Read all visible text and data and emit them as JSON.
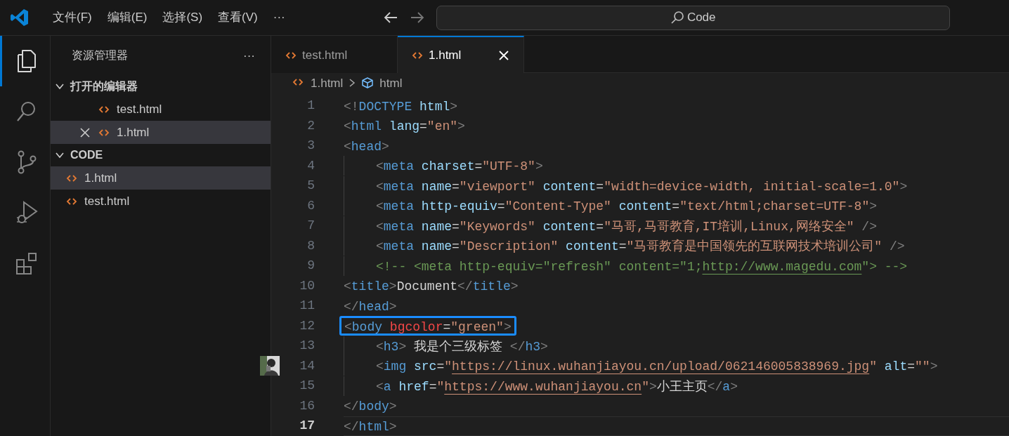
{
  "menu": [
    "文件(F)",
    "编辑(E)",
    "选择(S)",
    "查看(V)",
    "···"
  ],
  "command_center": {
    "text": "Code"
  },
  "activity_bar": [
    {
      "kind": "explorer",
      "selected": true
    },
    {
      "kind": "search",
      "selected": false
    },
    {
      "kind": "source-control",
      "selected": false
    },
    {
      "kind": "run-debug",
      "selected": false
    },
    {
      "kind": "extensions",
      "selected": false
    }
  ],
  "sidebar": {
    "title": "资源管理器",
    "more": "···",
    "sections": [
      {
        "title": "打开的编辑器",
        "expanded": true,
        "items": [
          {
            "label": "test.html",
            "selected": false,
            "close": false
          },
          {
            "label": "1.html",
            "selected": true,
            "close": true
          }
        ]
      },
      {
        "title": "CODE",
        "expanded": true,
        "items": [
          {
            "label": "1.html",
            "selected": true
          },
          {
            "label": "test.html",
            "selected": false
          }
        ]
      }
    ]
  },
  "tabs": [
    {
      "label": "test.html",
      "selected": false
    },
    {
      "label": "1.html",
      "selected": true
    }
  ],
  "breadcrumb": [
    "1.html",
    "html"
  ],
  "code_lines": [
    {
      "number": "1",
      "tokens": [
        {
          "t": "<!",
          "kind": "punct"
        },
        {
          "t": "DOCTYPE",
          "kind": "tag"
        },
        {
          "t": " html",
          "kind": "attr"
        },
        {
          "t": ">",
          "kind": "punct"
        }
      ]
    },
    {
      "number": "2",
      "tokens": [
        {
          "t": "<",
          "kind": "punct"
        },
        {
          "t": "html",
          "kind": "tag"
        },
        {
          "t": " lang",
          "kind": "attr"
        },
        {
          "t": "=",
          "kind": "text"
        },
        {
          "t": "\"en\"",
          "kind": "string"
        },
        {
          "t": ">",
          "kind": "punct"
        }
      ]
    },
    {
      "number": "3",
      "tokens": [
        {
          "t": "<",
          "kind": "punct"
        },
        {
          "t": "head",
          "kind": "tag"
        },
        {
          "t": ">",
          "kind": "punct"
        }
      ]
    },
    {
      "number": "4",
      "indented": true,
      "tokens": [
        {
          "t": "<",
          "kind": "punct"
        },
        {
          "t": "meta",
          "kind": "tag"
        },
        {
          "t": " charset",
          "kind": "attr"
        },
        {
          "t": "=",
          "kind": "text"
        },
        {
          "t": "\"UTF-8\"",
          "kind": "string"
        },
        {
          "t": ">",
          "kind": "punct"
        }
      ]
    },
    {
      "number": "5",
      "indented": true,
      "tokens": [
        {
          "t": "<",
          "kind": "punct"
        },
        {
          "t": "meta",
          "kind": "tag"
        },
        {
          "t": " name",
          "kind": "attr"
        },
        {
          "t": "=",
          "kind": "text"
        },
        {
          "t": "\"viewport\"",
          "kind": "string"
        },
        {
          "t": " content",
          "kind": "attr"
        },
        {
          "t": "=",
          "kind": "text"
        },
        {
          "t": "\"width=device-width, initial-scale=1.0\"",
          "kind": "string"
        },
        {
          "t": ">",
          "kind": "punct"
        }
      ]
    },
    {
      "number": "6",
      "indented": true,
      "tokens": [
        {
          "t": "<",
          "kind": "punct"
        },
        {
          "t": "meta",
          "kind": "tag"
        },
        {
          "t": " http-equiv",
          "kind": "attr"
        },
        {
          "t": "=",
          "kind": "text"
        },
        {
          "t": "\"Content-Type\"",
          "kind": "string"
        },
        {
          "t": " content",
          "kind": "attr"
        },
        {
          "t": "=",
          "kind": "text"
        },
        {
          "t": "\"text/html;charset=UTF-8\"",
          "kind": "string"
        },
        {
          "t": ">",
          "kind": "punct"
        }
      ]
    },
    {
      "number": "7",
      "indented": true,
      "tokens": [
        {
          "t": "<",
          "kind": "punct"
        },
        {
          "t": "meta",
          "kind": "tag"
        },
        {
          "t": " name",
          "kind": "attr"
        },
        {
          "t": "=",
          "kind": "text"
        },
        {
          "t": "\"Keywords\"",
          "kind": "string"
        },
        {
          "t": " content",
          "kind": "attr"
        },
        {
          "t": "=",
          "kind": "text"
        },
        {
          "t": "\"马哥,马哥教育,IT培训,Linux,网络安全\"",
          "kind": "string"
        },
        {
          "t": " />",
          "kind": "punct"
        }
      ]
    },
    {
      "number": "8",
      "indented": true,
      "tokens": [
        {
          "t": "<",
          "kind": "punct"
        },
        {
          "t": "meta",
          "kind": "tag"
        },
        {
          "t": " name",
          "kind": "attr"
        },
        {
          "t": "=",
          "kind": "text"
        },
        {
          "t": "\"Description\"",
          "kind": "string"
        },
        {
          "t": " content",
          "kind": "attr"
        },
        {
          "t": "=",
          "kind": "text"
        },
        {
          "t": "\"马哥教育是中国领先的互联网技术培训公司\"",
          "kind": "string"
        },
        {
          "t": " />",
          "kind": "punct"
        }
      ]
    },
    {
      "number": "9",
      "indented": true,
      "tokens": [
        {
          "t": "<!-- <meta http-equiv=\"refresh\" content=\"1;",
          "kind": "comment"
        },
        {
          "t": "http://www.magedu.com",
          "kind": "commentlink"
        },
        {
          "t": "\"> -->",
          "kind": "comment"
        }
      ]
    },
    {
      "number": "10",
      "tokens": [
        {
          "t": "<",
          "kind": "punct"
        },
        {
          "t": "title",
          "kind": "tag"
        },
        {
          "t": ">",
          "kind": "punct"
        },
        {
          "t": "Document",
          "kind": "text"
        },
        {
          "t": "</",
          "kind": "punct"
        },
        {
          "t": "title",
          "kind": "tag"
        },
        {
          "t": ">",
          "kind": "punct"
        }
      ]
    },
    {
      "number": "11",
      "tokens": [
        {
          "t": "</",
          "kind": "punct"
        },
        {
          "t": "head",
          "kind": "tag"
        },
        {
          "t": ">",
          "kind": "punct"
        }
      ]
    },
    {
      "number": "12",
      "boxed": true,
      "tokens": [
        {
          "t": "<",
          "kind": "punct"
        },
        {
          "t": "body",
          "kind": "tag"
        },
        {
          "t": " bgcolor",
          "kind": "error"
        },
        {
          "t": "=",
          "kind": "text"
        },
        {
          "t": "\"green\"",
          "kind": "string"
        },
        {
          "t": ">",
          "kind": "punct"
        }
      ]
    },
    {
      "number": "13",
      "indented": true,
      "tokens": [
        {
          "t": "<",
          "kind": "punct"
        },
        {
          "t": "h3",
          "kind": "tag"
        },
        {
          "t": ">",
          "kind": "punct"
        },
        {
          "t": " 我是个三级标签 ",
          "kind": "text"
        },
        {
          "t": "</",
          "kind": "punct"
        },
        {
          "t": "h3",
          "kind": "tag"
        },
        {
          "t": ">",
          "kind": "punct"
        }
      ]
    },
    {
      "number": "14",
      "indented": true,
      "gutter_picture": true,
      "tokens": [
        {
          "t": "<",
          "kind": "punct"
        },
        {
          "t": "img",
          "kind": "tag"
        },
        {
          "t": " src",
          "kind": "attr"
        },
        {
          "t": "=",
          "kind": "text"
        },
        {
          "t": "\"",
          "kind": "string"
        },
        {
          "t": "https://linux.wuhanjiayou.cn/upload/062146005838969.jpg",
          "kind": "link"
        },
        {
          "t": "\"",
          "kind": "string"
        },
        {
          "t": " alt",
          "kind": "attr"
        },
        {
          "t": "=",
          "kind": "text"
        },
        {
          "t": "\"\"",
          "kind": "string"
        },
        {
          "t": ">",
          "kind": "punct"
        }
      ]
    },
    {
      "number": "15",
      "indented": true,
      "tokens": [
        {
          "t": "<",
          "kind": "punct"
        },
        {
          "t": "a",
          "kind": "tag"
        },
        {
          "t": " href",
          "kind": "attr"
        },
        {
          "t": "=",
          "kind": "text"
        },
        {
          "t": "\"",
          "kind": "string"
        },
        {
          "t": "https://www.wuhanjiayou.cn",
          "kind": "link"
        },
        {
          "t": "\"",
          "kind": "string"
        },
        {
          "t": ">",
          "kind": "punct"
        },
        {
          "t": "小王主页",
          "kind": "text"
        },
        {
          "t": "</",
          "kind": "punct"
        },
        {
          "t": "a",
          "kind": "tag"
        },
        {
          "t": ">",
          "kind": "punct"
        }
      ]
    },
    {
      "number": "16",
      "tokens": [
        {
          "t": "</",
          "kind": "punct"
        },
        {
          "t": "body",
          "kind": "tag"
        },
        {
          "t": ">",
          "kind": "punct"
        }
      ]
    },
    {
      "number": "17",
      "current": true,
      "tokens": [
        {
          "t": "</",
          "kind": "punct"
        },
        {
          "t": "html",
          "kind": "tag"
        },
        {
          "t": ">",
          "kind": "punct"
        }
      ]
    }
  ]
}
